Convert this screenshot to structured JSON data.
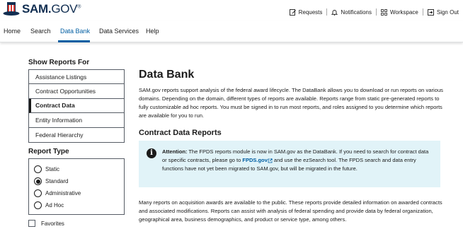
{
  "header": {
    "logo_text_main": "SAM.",
    "logo_text_gov": "GOV",
    "logo_reg": "®",
    "utility": [
      {
        "label": "Requests",
        "icon": "requests-icon"
      },
      {
        "label": "Notifications",
        "icon": "bell-icon"
      },
      {
        "label": "Workspace",
        "icon": "workspace-grid-icon"
      },
      {
        "label": "Sign Out",
        "icon": "sign-out-icon"
      }
    ]
  },
  "nav": {
    "items": [
      "Home",
      "Search",
      "Data Bank",
      "Data Services",
      "Help"
    ],
    "active": "Data Bank"
  },
  "sidebar": {
    "title": "Show Reports For",
    "reports": [
      "Assistance Listings",
      "Contract Opportunities",
      "Contract Data",
      "Entity Information",
      "Federal Hierarchy"
    ],
    "selected_report": "Contract Data",
    "type_title": "Report Type",
    "report_types": [
      "Static",
      "Standard",
      "Administrative",
      "Ad Hoc"
    ],
    "selected_type": "Standard",
    "favorites_label": "Favorites"
  },
  "main": {
    "title": "Data Bank",
    "description": "SAM.gov reports support analysis of the federal award lifecycle. The DataBank allows you to download or run reports on various domains. Depending on the domain, different types of reports are available. Reports range from static pre-generated reports to fully customizable ad hoc reports. You must be signed in to run most reports, and roles assigned to you determine which reports are available for you to run.",
    "section_title": "Contract Data Reports",
    "alert": {
      "label": "Attention:",
      "text_before_link": " The FPDS reports module is now in SAM.gov as the DataBank. If you need to search for contract data or specific contracts, please go to ",
      "link_text": "FPDS.gov",
      "text_after_link": " and use the ezSearch tool. The FPDS search and data entry functions have not yet been migrated to SAM.gov, but will be migrated in the future."
    },
    "body_paragraph": "Many reports on acquisition awards are available to the public. These reports provide detailed information on awarded contracts and associated modifications. Reports can assist with analysis of federal spending and provide data by federal organization, geographical area, business demographics, and product or service type, among others."
  },
  "colors": {
    "brand_navy": "#112e51",
    "brand_red": "#d83933",
    "link_blue": "#005ea2",
    "alert_bg": "#e1f3f8"
  }
}
